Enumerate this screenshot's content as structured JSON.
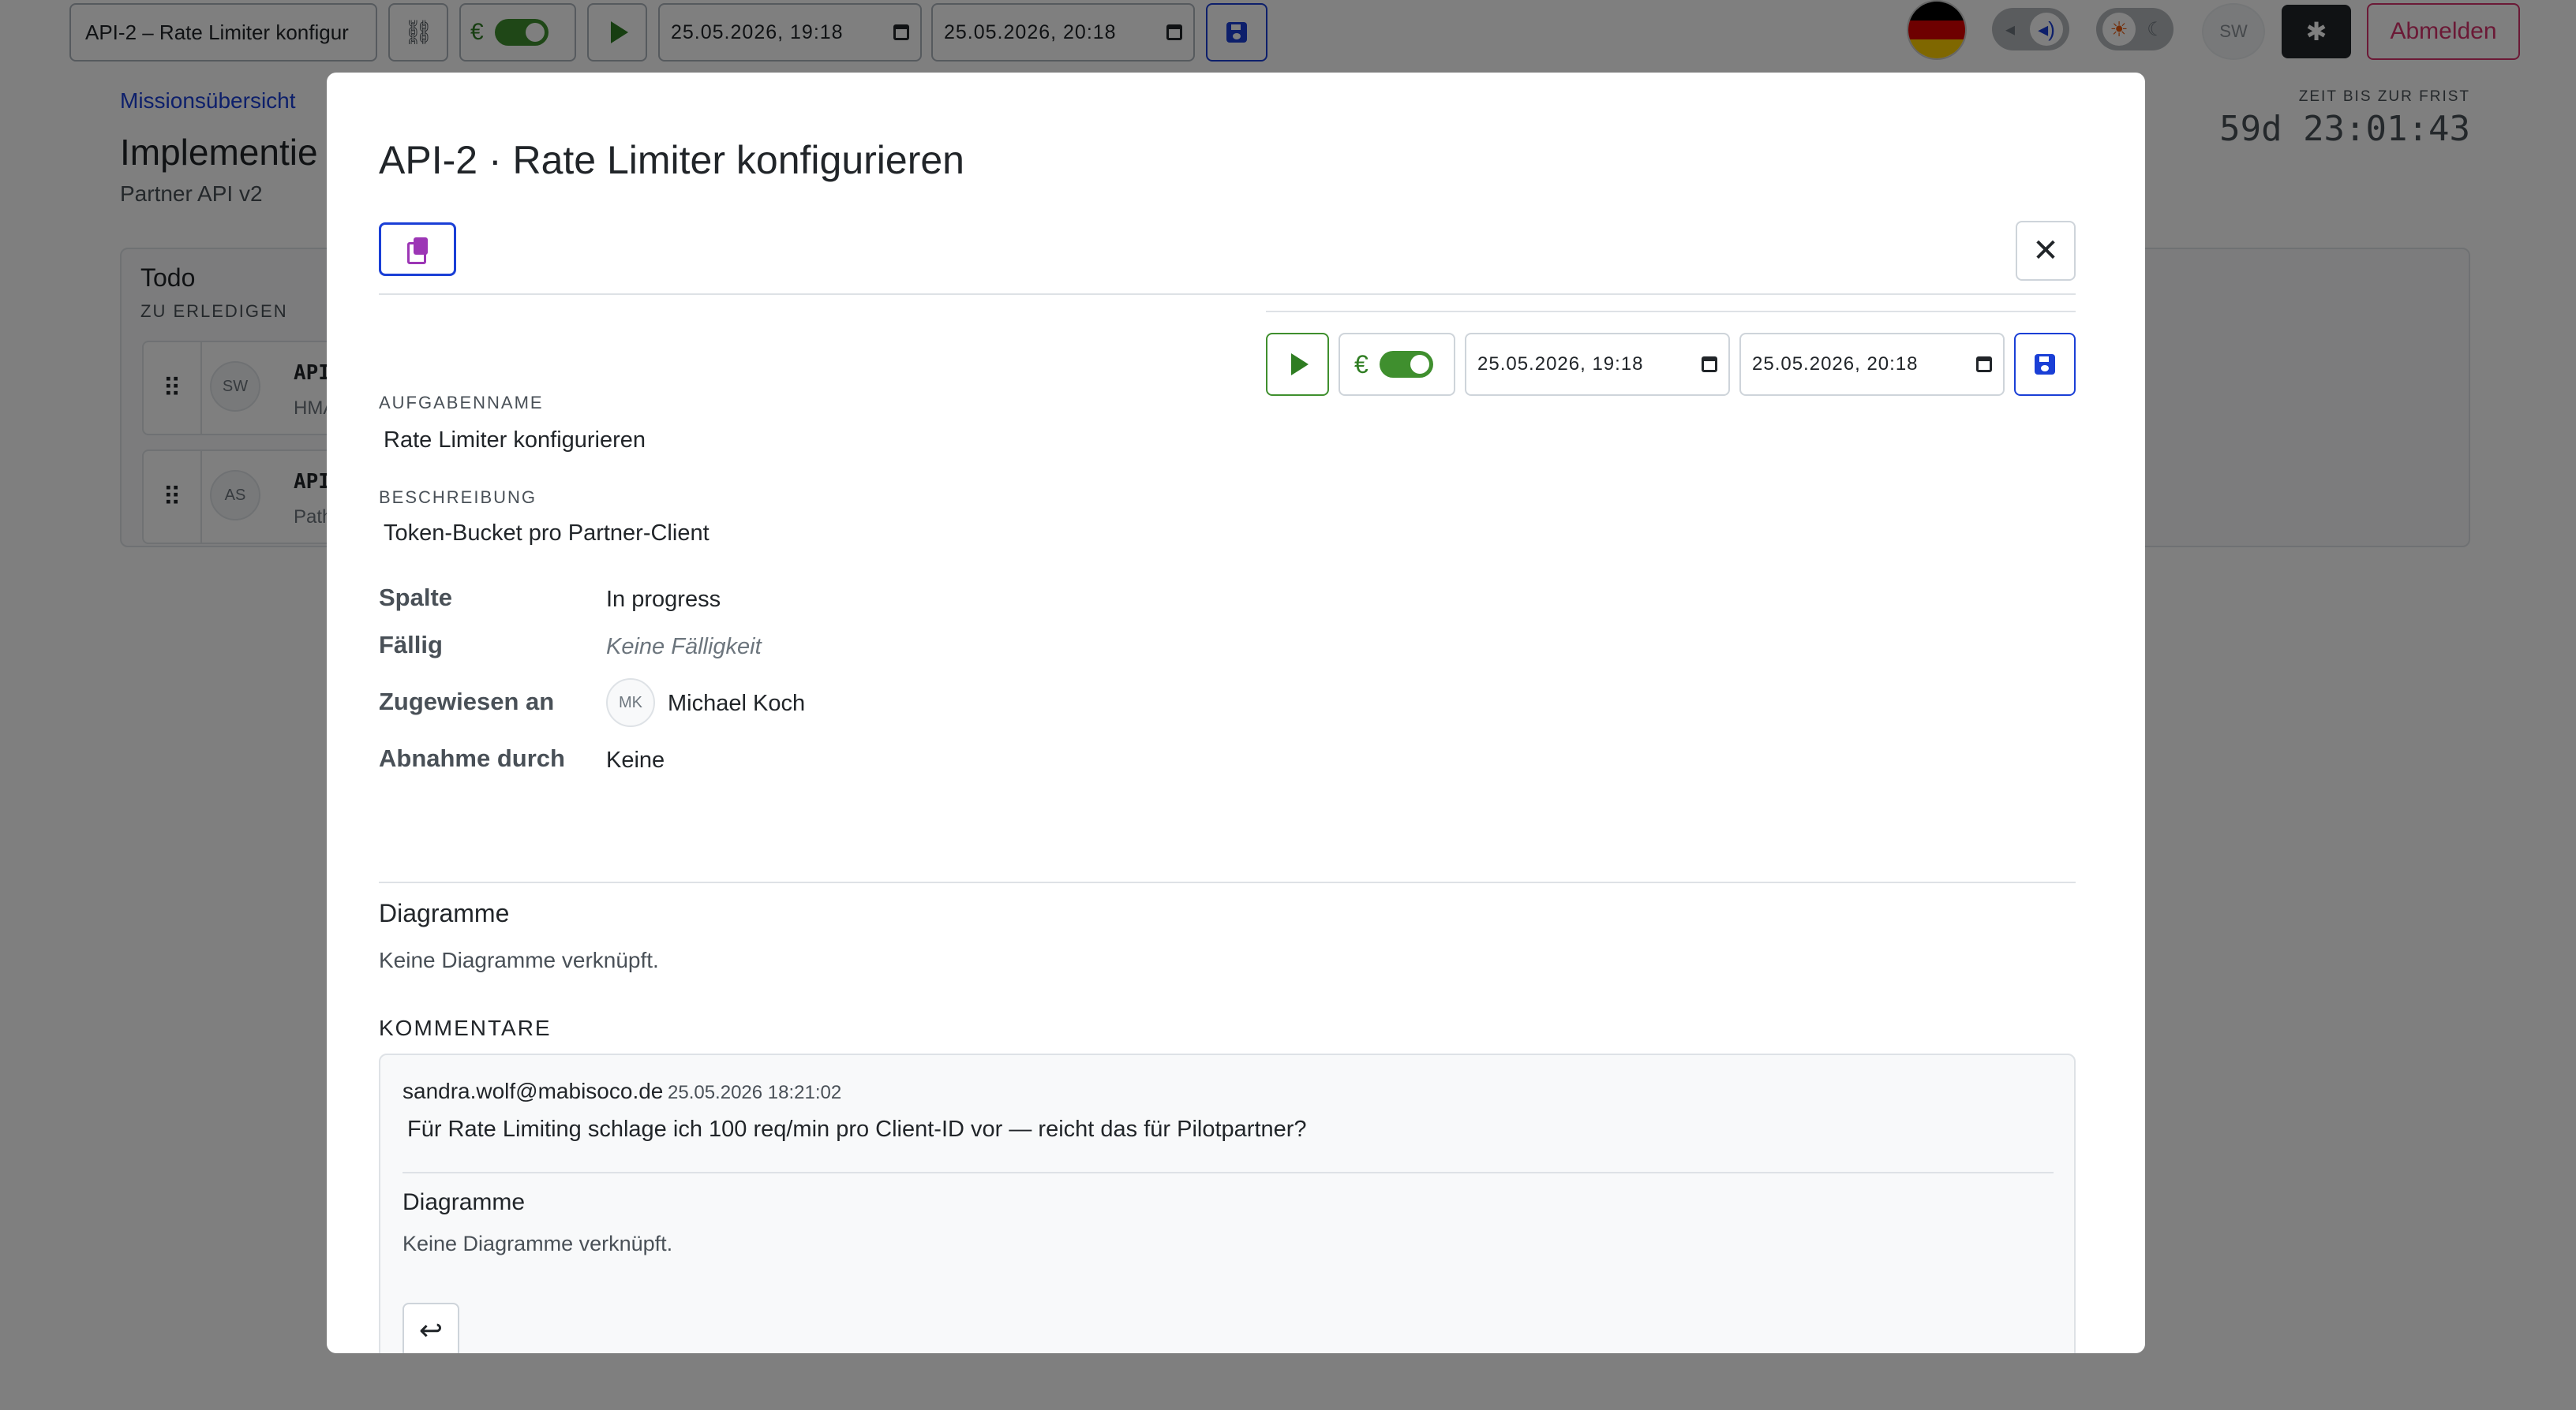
{
  "topbar": {
    "task_title": "API-2 – Rate Limiter konfigur",
    "date_start": "25.05.2026, 19:18",
    "date_end": "25.05.2026, 20:18",
    "user_initials": "SW",
    "logout_label": "Abmelden"
  },
  "page": {
    "breadcrumb": "Missionsübersicht",
    "title": "Implementie",
    "subtitle": "Partner API v2",
    "deadline_label": "ZEIT BIS ZUR FRIST",
    "deadline_value": "59d 23:01:43",
    "column": {
      "title": "Todo",
      "subtitle": "ZU ERLEDIGEN",
      "cards": [
        {
          "initials": "SW",
          "id": "API",
          "sub": "HMA"
        },
        {
          "initials": "AS",
          "id": "API",
          "sub": "Path"
        }
      ]
    }
  },
  "modal": {
    "title": "API-2 · Rate Limiter konfigurieren",
    "date_start": "25.05.2026, 19:18",
    "date_end": "25.05.2026, 20:18",
    "euro_symbol": "€",
    "task_name_label": "AUFGABENNAME",
    "task_name_value": "Rate Limiter konfigurieren",
    "description_label": "BESCHREIBUNG",
    "description_value": "Token-Bucket pro Partner-Client",
    "props": {
      "column_label": "Spalte",
      "column_value": "In progress",
      "due_label": "Fällig",
      "due_value": "Keine Fälligkeit",
      "assigned_label": "Zugewiesen an",
      "assigned_initials": "MK",
      "assigned_value": "Michael Koch",
      "approval_label": "Abnahme durch",
      "approval_value": "Keine"
    },
    "diagrams_heading": "Diagramme",
    "diagrams_empty": "Keine Diagramme verknüpft.",
    "comments_heading": "KOMMENTARE",
    "comments": [
      {
        "author": "sandra.wolf@mabisoco.de",
        "time": "25.05.2026 18:21:02",
        "text": "Für Rate Limiting schlage ich 100 req/min pro Client-ID vor — reicht das für Pilotpartner?",
        "diagrams_heading": "Diagramme",
        "diagrams_empty": "Keine Diagramme verknüpft."
      }
    ]
  },
  "colors": {
    "accent_blue": "#1a3fd6",
    "play_green": "#2f7d22",
    "logout_pink": "#d6336c",
    "copy_purple": "#9c36b5"
  }
}
